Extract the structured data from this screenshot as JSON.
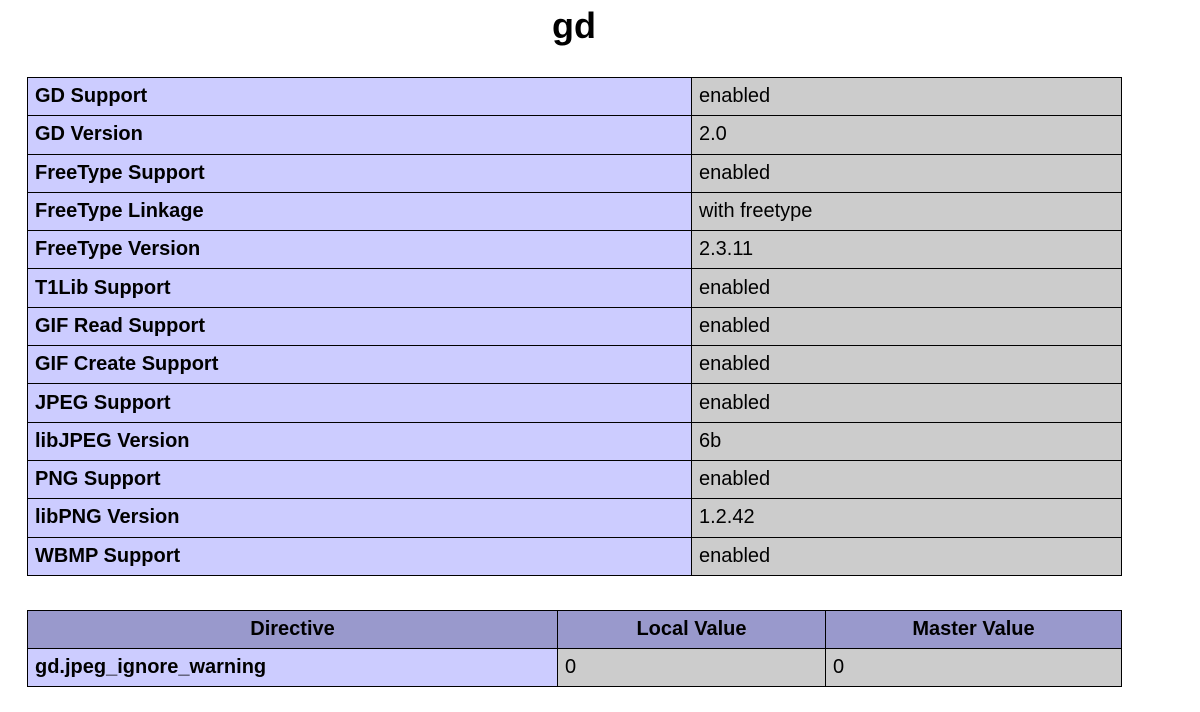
{
  "section_title": "gd",
  "info_rows": [
    {
      "name": "GD Support",
      "value": "enabled"
    },
    {
      "name": "GD Version",
      "value": "2.0"
    },
    {
      "name": "FreeType Support",
      "value": "enabled"
    },
    {
      "name": "FreeType Linkage",
      "value": "with freetype"
    },
    {
      "name": "FreeType Version",
      "value": "2.3.11"
    },
    {
      "name": "T1Lib Support",
      "value": "enabled"
    },
    {
      "name": "GIF Read Support",
      "value": "enabled"
    },
    {
      "name": "GIF Create Support",
      "value": "enabled"
    },
    {
      "name": "JPEG Support",
      "value": "enabled"
    },
    {
      "name": "libJPEG Version",
      "value": "6b"
    },
    {
      "name": "PNG Support",
      "value": "enabled"
    },
    {
      "name": "libPNG Version",
      "value": "1.2.42"
    },
    {
      "name": "WBMP Support",
      "value": "enabled"
    }
  ],
  "directive_table": {
    "headers": [
      "Directive",
      "Local Value",
      "Master Value"
    ],
    "rows": [
      {
        "directive": "gd.jpeg_ignore_warning",
        "local": "0",
        "master": "0"
      }
    ]
  },
  "colors": {
    "label_cell": "#ccccff",
    "value_cell": "#cccccc",
    "header_cell": "#9999cc"
  }
}
